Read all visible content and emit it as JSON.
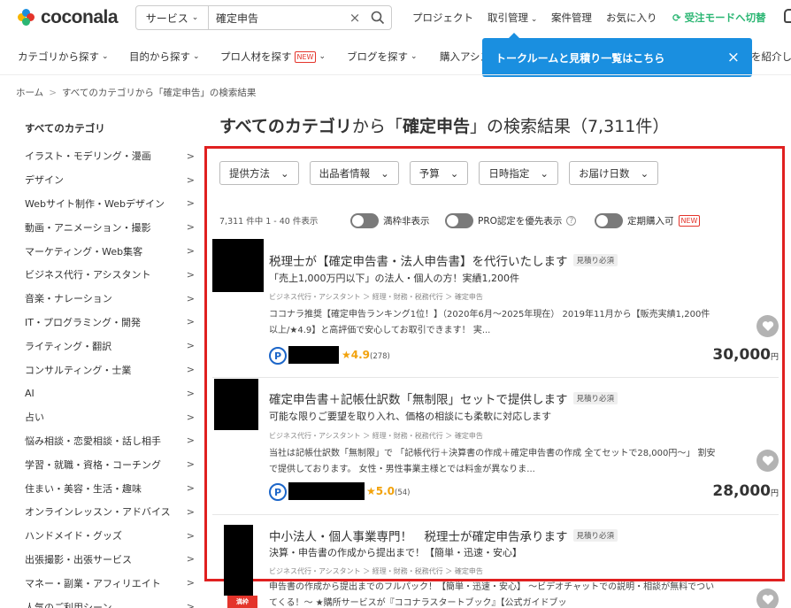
{
  "header": {
    "logo_text": "coconala",
    "logo_colors": [
      "#f7b500",
      "#1a8fe0",
      "#e4342b",
      "#2bb673"
    ],
    "search_scope": "サービス",
    "search_value": "確定申告",
    "nav": {
      "project": "プロジェクト",
      "deals": "取引管理",
      "jobs": "案件管理",
      "favorites": "お気に入り",
      "receive_mode": "受注モードへ切替"
    }
  },
  "subnav": {
    "category": "カテゴリから探す",
    "purpose": "目的から探す",
    "pros": "プロ人材を探す",
    "pros_badge": "NEW",
    "blog": "ブログを探す",
    "purchase_partial": "購入アシス",
    "intro_partial": "を紹介して"
  },
  "tooltip": {
    "text": "トークルームと見積り一覧はこちら"
  },
  "breadcrumb": [
    "ホーム",
    "すべてのカテゴリから「確定申告」の検索結果"
  ],
  "sidebar": {
    "title": "すべてのカテゴリ",
    "items": [
      "イラスト・モデリング・漫画",
      "デザイン",
      "Webサイト制作・Webデザイン",
      "動画・アニメーション・撮影",
      "マーケティング・Web集客",
      "ビジネス代行・アシスタント",
      "音楽・ナレーション",
      "IT・プログラミング・開発",
      "ライティング・翻訳",
      "コンサルティング・士業",
      "AI",
      "占い",
      "悩み相談・恋愛相談・話し相手",
      "学習・就職・資格・コーチング",
      "住まい・美容・生活・趣味",
      "オンラインレッスン・アドバイス",
      "ハンドメイド・グッズ",
      "出張撮影・出張サービス",
      "マネー・副業・アフィリエイト",
      "人気のご利用シーン"
    ]
  },
  "main": {
    "title_part1": "すべてのカテゴリ",
    "title_part2": "から「",
    "title_keyword": "確定申告",
    "title_part3": "」の検索結果",
    "title_count": "（7,311件）",
    "filters": [
      "提供方法",
      "出品者情報",
      "予算",
      "日時指定",
      "お届け日数"
    ],
    "result_count": "7,311 件中 1 - 40 件表示",
    "toggles": {
      "hide_full": "満枠非表示",
      "pro_first": "PRO認定を優先表示",
      "subscription": "定期購入可",
      "subscription_badge": "NEW"
    },
    "listings": [
      {
        "title": "税理士が【確定申告書・法人申告書】を代行いたします",
        "estimate": "見積り必須",
        "catch": "「売上1,000万円以下」の法人・個人の方！実績1,200件",
        "category": "ビジネス代行・アシスタント ＞ 経理・財務・税務代行 ＞ 確定申告",
        "desc": "ココナラ推奨【確定申告ランキング1位！】（2020年6月〜2025年現在） 2019年11月から【販売実績1,200件以上/★4.9】と高評価で安心してお取引できます！ 実...",
        "pro": "P",
        "rating": "★4.9",
        "reviews": "(278)",
        "price": "30,000",
        "currency": "円"
      },
      {
        "title": "確定申告書＋記帳仕訳数「無制限」セットで提供します",
        "estimate": "見積り必須",
        "catch": "可能な限りご要望を取り入れ、価格の相談にも柔軟に対応します",
        "category": "ビジネス代行・アシスタント ＞ 経理・財務・税務代行 ＞ 確定申告",
        "desc": "当社は記帳仕訳数「無制限」で 「記帳代行＋決算書の作成＋確定申告書の作成 全てセットで28,000円〜」 割安で提供しております。 女性・男性事業主様とでは料金が異なりま...",
        "pro": "P",
        "rating": "★5.0",
        "reviews": "(54)",
        "price": "28,000",
        "currency": "円"
      },
      {
        "title": "中小法人・個人事業専門！　税理士が確定申告承ります",
        "estimate": "見積り必須",
        "catch": "決算・申告書の作成から提出まで！【簡単・迅速・安心】",
        "category": "ビジネス代行・アシスタント ＞ 経理・財務・税務代行 ＞ 確定申告",
        "desc": "申告書の作成から提出までのフルパック！【簡単・迅速・安心】 〜ビデオチャットでの説明・相談が無料でついてくる！〜 ★購所サービスが『ココナラスタートブック』【公式ガイドブッ"
      }
    ],
    "ribbon": "満枠"
  }
}
